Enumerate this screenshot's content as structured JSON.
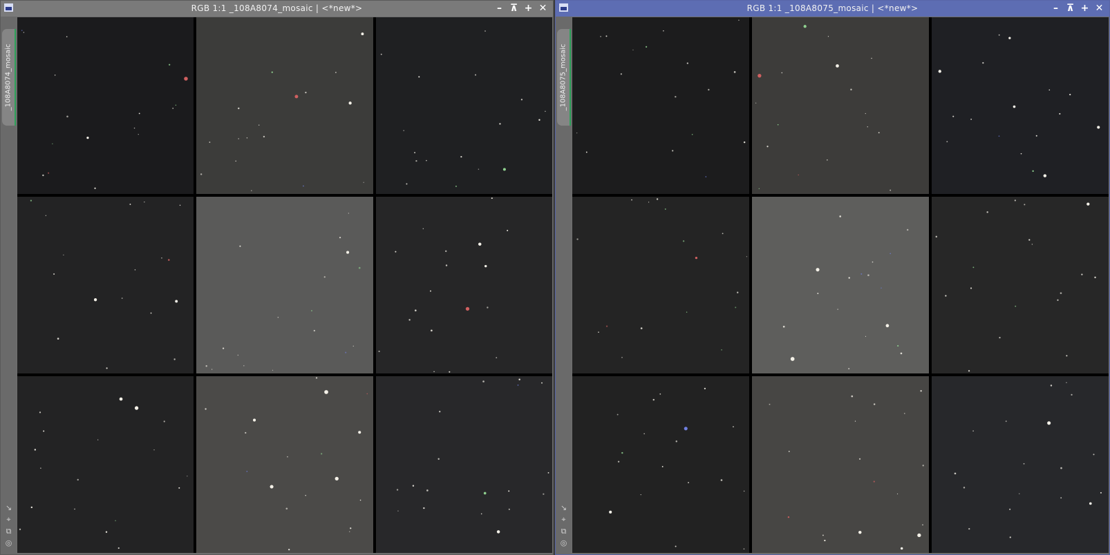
{
  "windows": [
    {
      "id": "left",
      "title": "RGB 1:1 _108A8074_mosaic | <*new*>",
      "vertical_tab": "_108A8074_mosaic",
      "active": false,
      "tile_colors": [
        "#1b1b1d",
        "#3c3c3a",
        "#1f2022",
        "#232324",
        "#5a5a59",
        "#262627",
        "#232324",
        "#4b4a48",
        "#28282a"
      ]
    },
    {
      "id": "right",
      "title": "RGB 1:1 _108A8075_mosaic | <*new*>",
      "vertical_tab": "_108A8075_mosaic",
      "active": true,
      "tile_colors": [
        "#1c1c1d",
        "#3d3c3a",
        "#1f2024",
        "#242424",
        "#5e5e5c",
        "#272727",
        "#222222",
        "#474644",
        "#27282b"
      ]
    }
  ],
  "controls": [
    "minimize-icon",
    "shade-icon",
    "maximize-icon",
    "close-icon"
  ],
  "tools": [
    "resize-icon",
    "fit-view-icon",
    "clone-icon",
    "target-icon"
  ],
  "colors": {
    "active_title": "#5d6db3",
    "inactive_title": "#7a7a7a",
    "tab_accent": "#2ea25b"
  }
}
